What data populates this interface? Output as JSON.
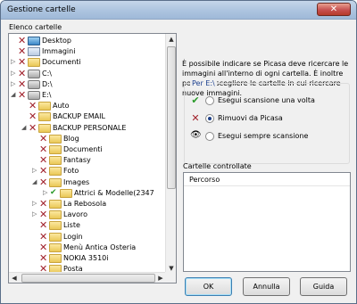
{
  "window": {
    "title": "Gestione cartelle",
    "close_glyph": "✕"
  },
  "tree": {
    "label": "Elenco cartelle",
    "items": [
      {
        "label": "Desktop",
        "mark": "x",
        "icon": "desktop-icon",
        "expander": ""
      },
      {
        "label": "Immagini",
        "mark": "x",
        "icon": "images-folder-icon",
        "expander": ""
      },
      {
        "label": "Documenti",
        "mark": "x",
        "icon": "folder-icon",
        "expander": "▷"
      },
      {
        "label": "C:\\",
        "mark": "x",
        "icon": "drive-icon",
        "expander": "▷"
      },
      {
        "label": "D:\\",
        "mark": "x",
        "icon": "drive-icon",
        "expander": "▷"
      },
      {
        "label": "E:\\",
        "mark": "x",
        "icon": "drive-icon",
        "expander": "◢"
      },
      {
        "label": "Auto",
        "mark": "x",
        "icon": "folder-icon",
        "expander": ""
      },
      {
        "label": "BACKUP EMAIL",
        "mark": "x",
        "icon": "folder-icon",
        "expander": ""
      },
      {
        "label": "BACKUP PERSONALE",
        "mark": "x",
        "icon": "folder-icon",
        "expander": "◢"
      },
      {
        "label": "Blog",
        "mark": "x",
        "icon": "folder-icon",
        "expander": ""
      },
      {
        "label": "Documenti",
        "mark": "x",
        "icon": "folder-icon",
        "expander": ""
      },
      {
        "label": "Fantasy",
        "mark": "x",
        "icon": "folder-icon",
        "expander": ""
      },
      {
        "label": "Foto",
        "mark": "x",
        "icon": "folder-icon",
        "expander": "▷"
      },
      {
        "label": "Images",
        "mark": "x",
        "icon": "folder-icon",
        "expander": "◢"
      },
      {
        "label": "Attrici & Modelle(2347",
        "mark": "check",
        "icon": "folder-icon",
        "expander": "▷"
      },
      {
        "label": "La Rebosola",
        "mark": "x",
        "icon": "folder-icon",
        "expander": "▷"
      },
      {
        "label": "Lavoro",
        "mark": "x",
        "icon": "folder-icon",
        "expander": "▷"
      },
      {
        "label": "Liste",
        "mark": "x",
        "icon": "folder-icon",
        "expander": ""
      },
      {
        "label": "Login",
        "mark": "x",
        "icon": "folder-icon",
        "expander": ""
      },
      {
        "label": "Menù Antica Osteria",
        "mark": "x",
        "icon": "folder-icon",
        "expander": ""
      },
      {
        "label": "NOKIA 3510i",
        "mark": "x",
        "icon": "folder-icon",
        "expander": ""
      },
      {
        "label": "Posta",
        "mark": "x",
        "icon": "folder-icon",
        "expander": ""
      }
    ]
  },
  "info_text": "È possibile indicare se Picasa deve ricercare le immagini all'interno di ogni cartella. È inoltre possibile scegliere le cartelle in cui ricercare nuove immagini.",
  "options_group": {
    "legend": "Per E:\\",
    "options": [
      {
        "label": "Esegui scansione una volta",
        "icon_glyph": "✔",
        "selected": false
      },
      {
        "label": "Rimuovi da Picasa",
        "icon_glyph": "✕",
        "selected": true
      },
      {
        "label": "Esegui sempre scansione",
        "icon_glyph": "👁",
        "selected": false
      }
    ]
  },
  "monitored": {
    "label": "Cartelle controllate",
    "column_header": "Percorso"
  },
  "buttons": {
    "ok": "OK",
    "cancel": "Annulla",
    "help": "Guida"
  },
  "colors": {
    "x_mark": "#a0202a",
    "check_mark": "#2a9a2a",
    "legend": "#1b3f8f"
  }
}
